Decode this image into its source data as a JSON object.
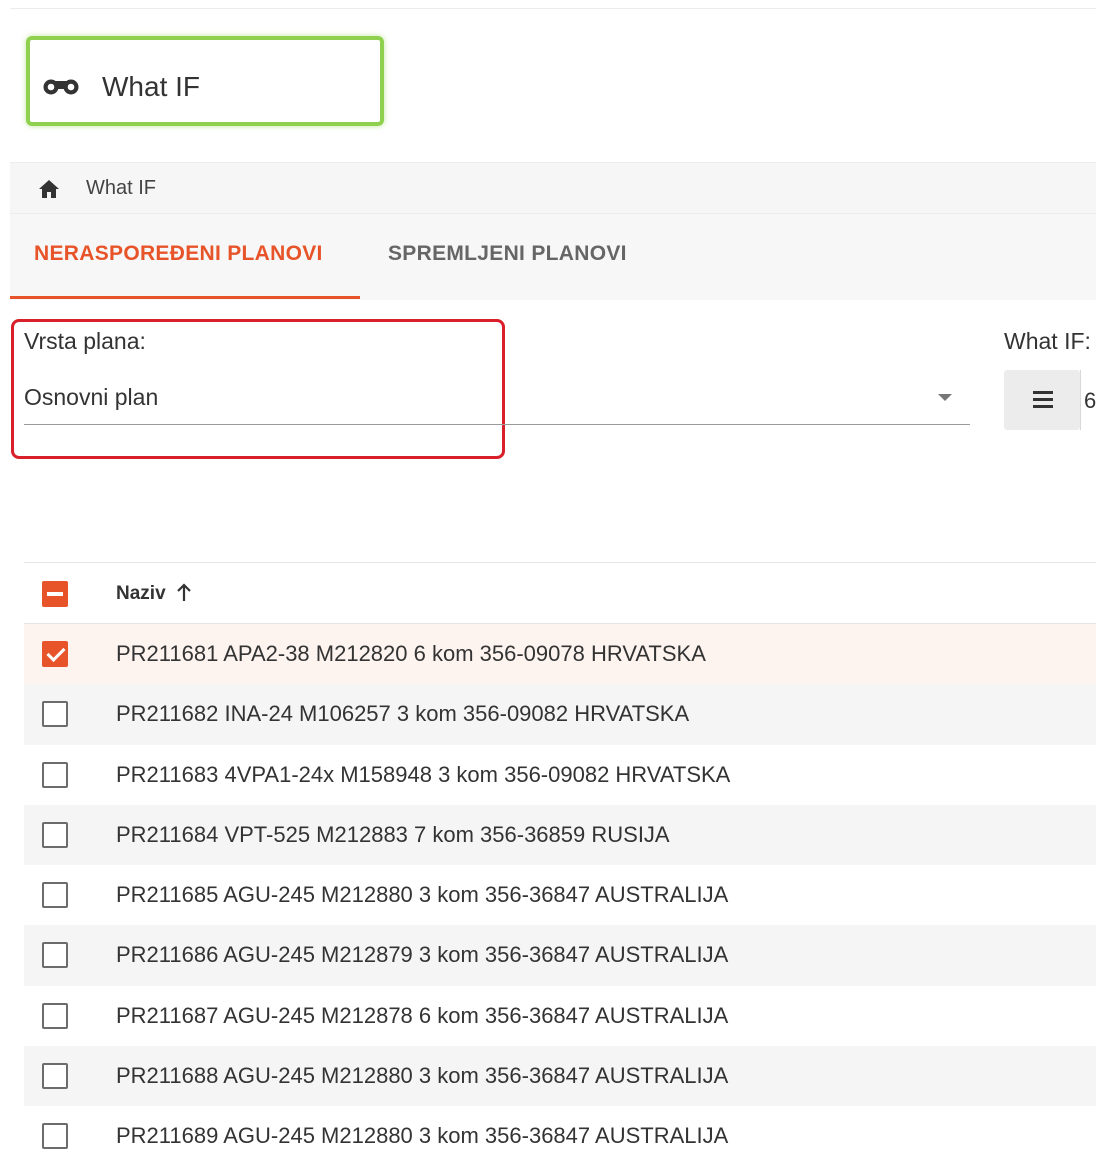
{
  "header": {
    "title": "What IF",
    "icon": "binoculars-icon"
  },
  "breadcrumb": {
    "home_icon": "home-icon",
    "current": "What IF"
  },
  "tabs": [
    {
      "label": "NERASPOREĐENI PLANOVI",
      "active": true
    },
    {
      "label": "SPREMLJENI PLANOVI",
      "active": false
    }
  ],
  "filters": {
    "plan_type_label": "Vrsta plana:",
    "plan_type_value": "Osnovni plan",
    "whatif_label": "What IF:",
    "whatif_value": "6"
  },
  "table": {
    "header_checkbox": "indeterminate",
    "column": "Naziv",
    "sort": "ascending",
    "rows": [
      {
        "name": "PR211681 APA2-38 M212820 6 kom 356-09078 HRVATSKA",
        "checked": true
      },
      {
        "name": "PR211682 INA-24 M106257 3 kom 356-09082 HRVATSKA",
        "checked": false
      },
      {
        "name": "PR211683 4VPA1-24x M158948 3 kom 356-09082 HRVATSKA",
        "checked": false
      },
      {
        "name": "PR211684 VPT-525 M212883 7 kom 356-36859 RUSIJA",
        "checked": false
      },
      {
        "name": "PR211685 AGU-245 M212880 3 kom 356-36847 AUSTRALIJA",
        "checked": false
      },
      {
        "name": "PR211686 AGU-245 M212879 3 kom 356-36847 AUSTRALIJA",
        "checked": false
      },
      {
        "name": "PR211687 AGU-245 M212878 6 kom 356-36847 AUSTRALIJA",
        "checked": false
      },
      {
        "name": "PR211688 AGU-245 M212880 3 kom 356-36847 AUSTRALIJA",
        "checked": false
      },
      {
        "name": "PR211689 AGU-245 M212880 3 kom 356-36847 AUSTRALIJA",
        "checked": false
      }
    ]
  },
  "colors": {
    "accent": "#e8542a",
    "title_highlight": "#8fd14f",
    "field_highlight": "#d9202a"
  }
}
